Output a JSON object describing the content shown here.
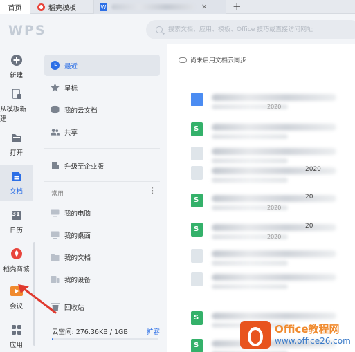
{
  "tabs": {
    "home": "首页",
    "template_tab": "稻壳模板",
    "doc_tab_icon": "W",
    "close": "✕",
    "new_tab": "+"
  },
  "header": {
    "logo": "WPS",
    "search_placeholder": "搜索文档、应用、模板、Office 技巧或直接访问网址"
  },
  "rail": {
    "items": [
      {
        "label": "新建",
        "icon": "plus-circle-icon"
      },
      {
        "label": "从模板新建",
        "icon": "template-icon"
      },
      {
        "label": "打开",
        "icon": "folder-icon"
      },
      {
        "label": "文档",
        "icon": "document-icon"
      },
      {
        "label": "日历",
        "icon": "calendar-icon"
      },
      {
        "label": "稻壳商城",
        "icon": "daoke-icon"
      },
      {
        "label": "会议",
        "icon": "meeting-icon"
      },
      {
        "label": "应用",
        "icon": "apps-icon"
      }
    ],
    "calendar_day": "31"
  },
  "nav": {
    "items": [
      {
        "label": "最近",
        "icon": "clock-icon"
      },
      {
        "label": "星标",
        "icon": "star-icon"
      },
      {
        "label": "我的云文档",
        "icon": "cloud-box-icon"
      },
      {
        "label": "共享",
        "icon": "people-icon"
      }
    ],
    "upgrade": "升级至企业版",
    "section_label": "常用",
    "more": "⋮",
    "common": [
      {
        "label": "我的电脑",
        "icon": "computer-icon"
      },
      {
        "label": "我的桌面",
        "icon": "desktop-icon"
      },
      {
        "label": "我的文档",
        "icon": "my-docs-icon"
      },
      {
        "label": "我的设备",
        "icon": "device-icon"
      }
    ],
    "recycle": "回收站",
    "storage_text": "云空间: 276.36KB / 1GB",
    "storage_expand": "扩容",
    "storage_used_fraction": 0.0003
  },
  "main": {
    "sync_text": "尚未启用文档云同步",
    "rows": [
      {
        "icon": "blue",
        "title": "",
        "meta": "2020"
      },
      {
        "icon": "green",
        "title": "",
        "meta": ""
      },
      {
        "icon": "light",
        "title": "",
        "meta": ""
      },
      {
        "icon": "light",
        "title": "2020",
        "meta": ""
      },
      {
        "icon": "green",
        "title": "20",
        "meta": "2020"
      },
      {
        "icon": "green",
        "title": "20",
        "meta": "2020"
      },
      {
        "icon": "light",
        "title": "",
        "meta": ""
      },
      {
        "icon": "light",
        "title": "",
        "meta": ""
      },
      {
        "icon": "green",
        "title": "",
        "meta": ""
      },
      {
        "icon": "green",
        "title": "",
        "meta": ""
      }
    ]
  },
  "watermark": {
    "line1": "Office教程网",
    "line2": "www.office26.com"
  }
}
